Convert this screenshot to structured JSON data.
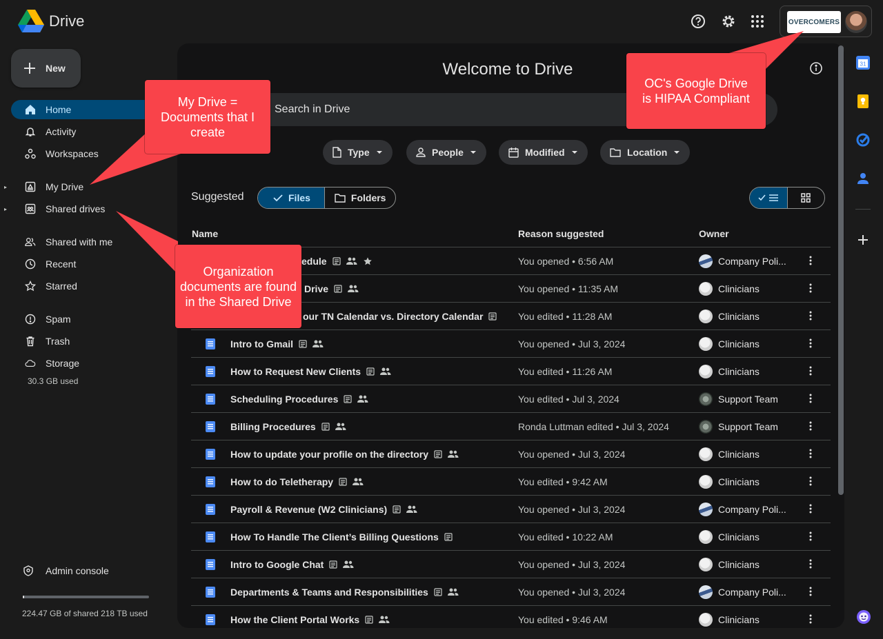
{
  "app": {
    "title": "Drive"
  },
  "account": {
    "org_logo_text": "OVERCOMERS"
  },
  "new_button": {
    "label": "New"
  },
  "sidebar": {
    "items": [
      {
        "label": "Home",
        "icon": "home-icon",
        "active": true
      },
      {
        "label": "Activity",
        "icon": "bell-icon"
      },
      {
        "label": "Workspaces",
        "icon": "workspaces-icon"
      },
      {
        "label": "My Drive",
        "icon": "my-drive-icon"
      },
      {
        "label": "Shared drives",
        "icon": "shared-drives-icon"
      },
      {
        "label": "Shared with me",
        "icon": "people-icon"
      },
      {
        "label": "Recent",
        "icon": "clock-icon"
      },
      {
        "label": "Starred",
        "icon": "star-icon"
      },
      {
        "label": "Spam",
        "icon": "spam-icon"
      },
      {
        "label": "Trash",
        "icon": "trash-icon"
      },
      {
        "label": "Storage",
        "icon": "cloud-icon"
      }
    ],
    "storage_used": "30.3 GB used",
    "admin_console": "Admin console",
    "quota_fraction": 0.001,
    "quota_text": "224.47 GB of shared 218 TB used"
  },
  "main": {
    "welcome": "Welcome to Drive",
    "search_placeholder": "Search in Drive",
    "filters": [
      "Type",
      "People",
      "Modified",
      "Location"
    ],
    "suggested_label": "Suggested",
    "toggle": {
      "files": "Files",
      "folders": "Folders"
    },
    "columns": {
      "name": "Name",
      "reason": "Reason suggested",
      "owner": "Owner"
    },
    "rows": [
      {
        "name": "edule",
        "reason": "You opened • 6:56 AM",
        "owner": "Company Poli...",
        "avatar": "company",
        "shared": true,
        "starred": true,
        "partial": true
      },
      {
        "name": "Drive",
        "reason": "You opened • 11:35 AM",
        "owner": "Clinicians",
        "avatar": "clin",
        "shared": true,
        "partial": true
      },
      {
        "name": "our TN Calendar vs. Directory Calendar",
        "reason": "You edited • 11:28 AM",
        "owner": "Clinicians",
        "avatar": "clin",
        "shared": false,
        "partial": true
      },
      {
        "name": "Intro to Gmail",
        "reason": "You opened • Jul 3, 2024",
        "owner": "Clinicians",
        "avatar": "clin",
        "shared": true
      },
      {
        "name": "How to Request New Clients",
        "reason": "You edited • 11:26 AM",
        "owner": "Clinicians",
        "avatar": "clin",
        "shared": true
      },
      {
        "name": "Scheduling Procedures",
        "reason": "You edited • Jul 3, 2024",
        "owner": "Support Team",
        "avatar": "support",
        "shared": true
      },
      {
        "name": "Billing Procedures",
        "reason": "Ronda Luttman edited • Jul 3, 2024",
        "owner": "Support Team",
        "avatar": "support",
        "shared": true
      },
      {
        "name": "How to update your profile on the directory",
        "reason": "You opened • Jul 3, 2024",
        "owner": "Clinicians",
        "avatar": "clin",
        "shared": true
      },
      {
        "name": "How to do Teletherapy",
        "reason": "You edited • 9:42 AM",
        "owner": "Clinicians",
        "avatar": "clin",
        "shared": true
      },
      {
        "name": "Payroll & Revenue (W2 Clinicians)",
        "reason": "You opened • Jul 3, 2024",
        "owner": "Company Poli...",
        "avatar": "company",
        "shared": true
      },
      {
        "name": "How To Handle The Client’s Billing Questions",
        "reason": "You edited • 10:22 AM",
        "owner": "Clinicians",
        "avatar": "clin",
        "shared": false
      },
      {
        "name": "Intro to Google Chat",
        "reason": "You opened • Jul 3, 2024",
        "owner": "Clinicians",
        "avatar": "clin",
        "shared": true
      },
      {
        "name": "Departments & Teams and Responsibilities",
        "reason": "You opened • Jul 3, 2024",
        "owner": "Company Poli...",
        "avatar": "company",
        "shared": true
      },
      {
        "name": "How the Client Portal Works",
        "reason": "You edited • 9:46 AM",
        "owner": "Clinicians",
        "avatar": "clin",
        "shared": true
      }
    ]
  },
  "rail": {
    "calendar_day": "31"
  },
  "callouts": {
    "my_drive": "My Drive = Documents that I create",
    "hipaa": "OC's Google Drive is HIPAA Compliant",
    "shared": "Organization documents are found in the Shared Drive"
  },
  "colors": {
    "callout": "#f9434a",
    "active_nav": "#004a77",
    "accent_text": "#c2e7ff",
    "doc_blue": "#4c8bf5"
  }
}
